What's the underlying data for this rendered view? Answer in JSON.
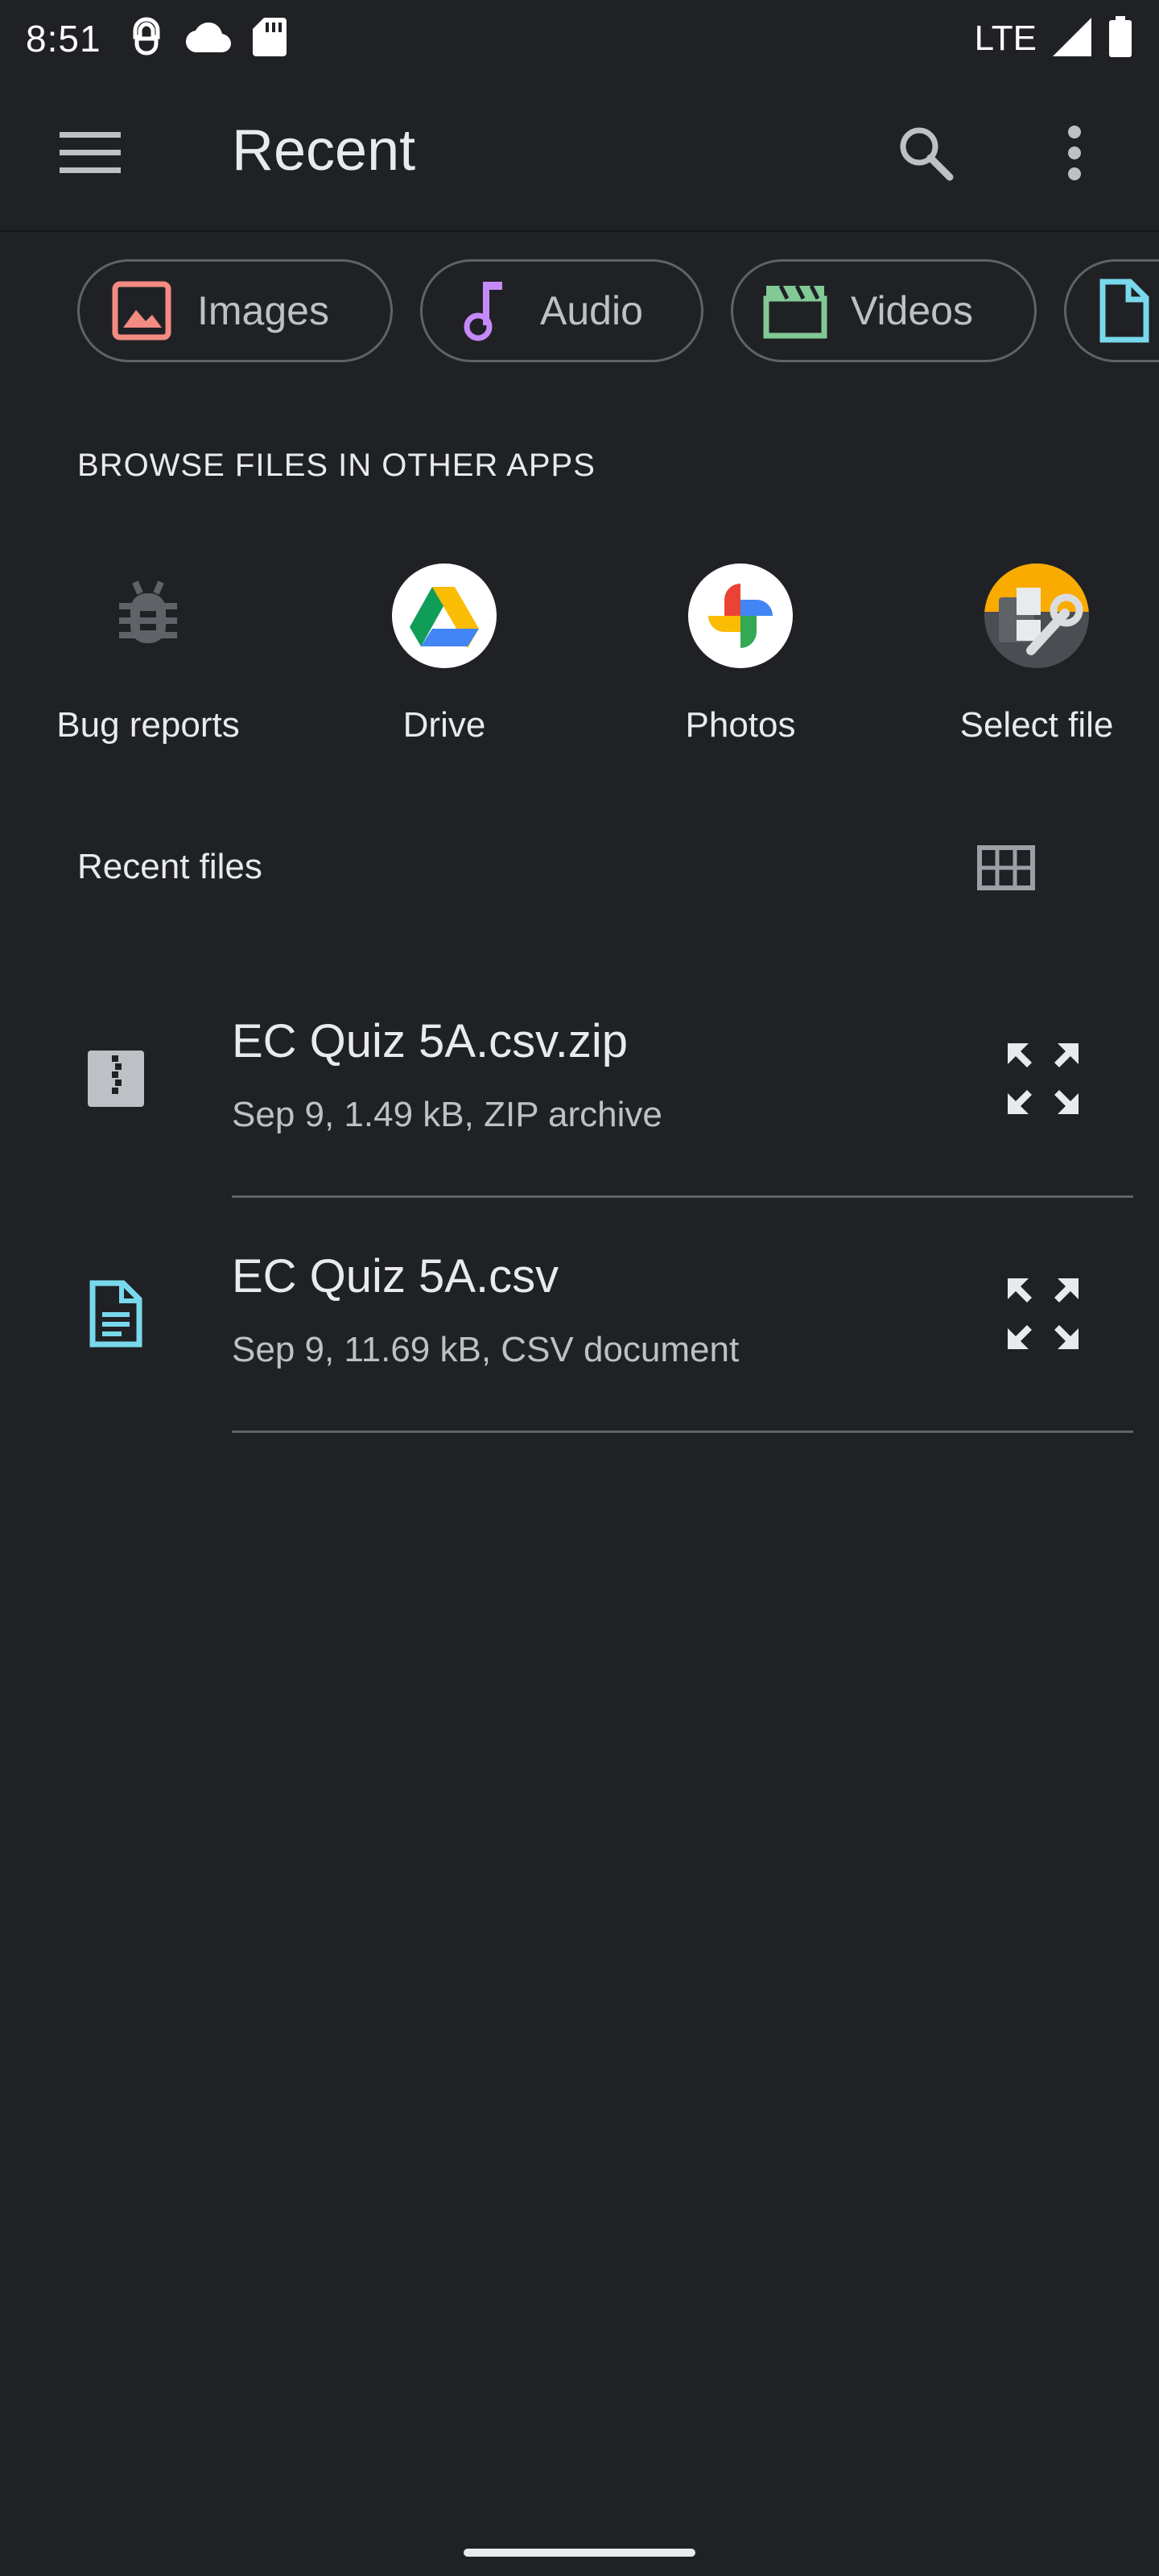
{
  "status_bar": {
    "time": "8:51",
    "network": "LTE"
  },
  "app_bar": {
    "title": "Recent"
  },
  "chips": [
    {
      "label": "Images",
      "icon": "image-icon",
      "color": "#f28b82"
    },
    {
      "label": "Audio",
      "icon": "music-note-icon",
      "color": "#c58af9"
    },
    {
      "label": "Videos",
      "icon": "video-icon",
      "color": "#81c995"
    },
    {
      "label": "",
      "icon": "document-icon",
      "color": "#78d9ec"
    }
  ],
  "browse_section": {
    "title": "BROWSE FILES IN OTHER APPS",
    "apps": [
      {
        "label": "Bug reports",
        "icon": "bug-icon"
      },
      {
        "label": "Drive",
        "icon": "google-drive-icon"
      },
      {
        "label": "Photos",
        "icon": "google-photos-icon"
      },
      {
        "label": "Select file",
        "icon": "select-file-icon"
      }
    ]
  },
  "recent_section": {
    "title": "Recent files"
  },
  "files": [
    {
      "name": "EC Quiz 5A.csv.zip",
      "meta": "Sep 9, 1.49 kB, ZIP archive",
      "icon": "zip-file-icon"
    },
    {
      "name": "EC Quiz 5A.csv",
      "meta": "Sep 9, 11.69 kB, CSV document",
      "icon": "text-document-icon"
    }
  ],
  "colors": {
    "background": "#202124",
    "primary_text": "#e8eaed",
    "secondary_text": "#bdc1c6",
    "outline": "#5f6368",
    "doc_accent": "#78d9ec"
  }
}
